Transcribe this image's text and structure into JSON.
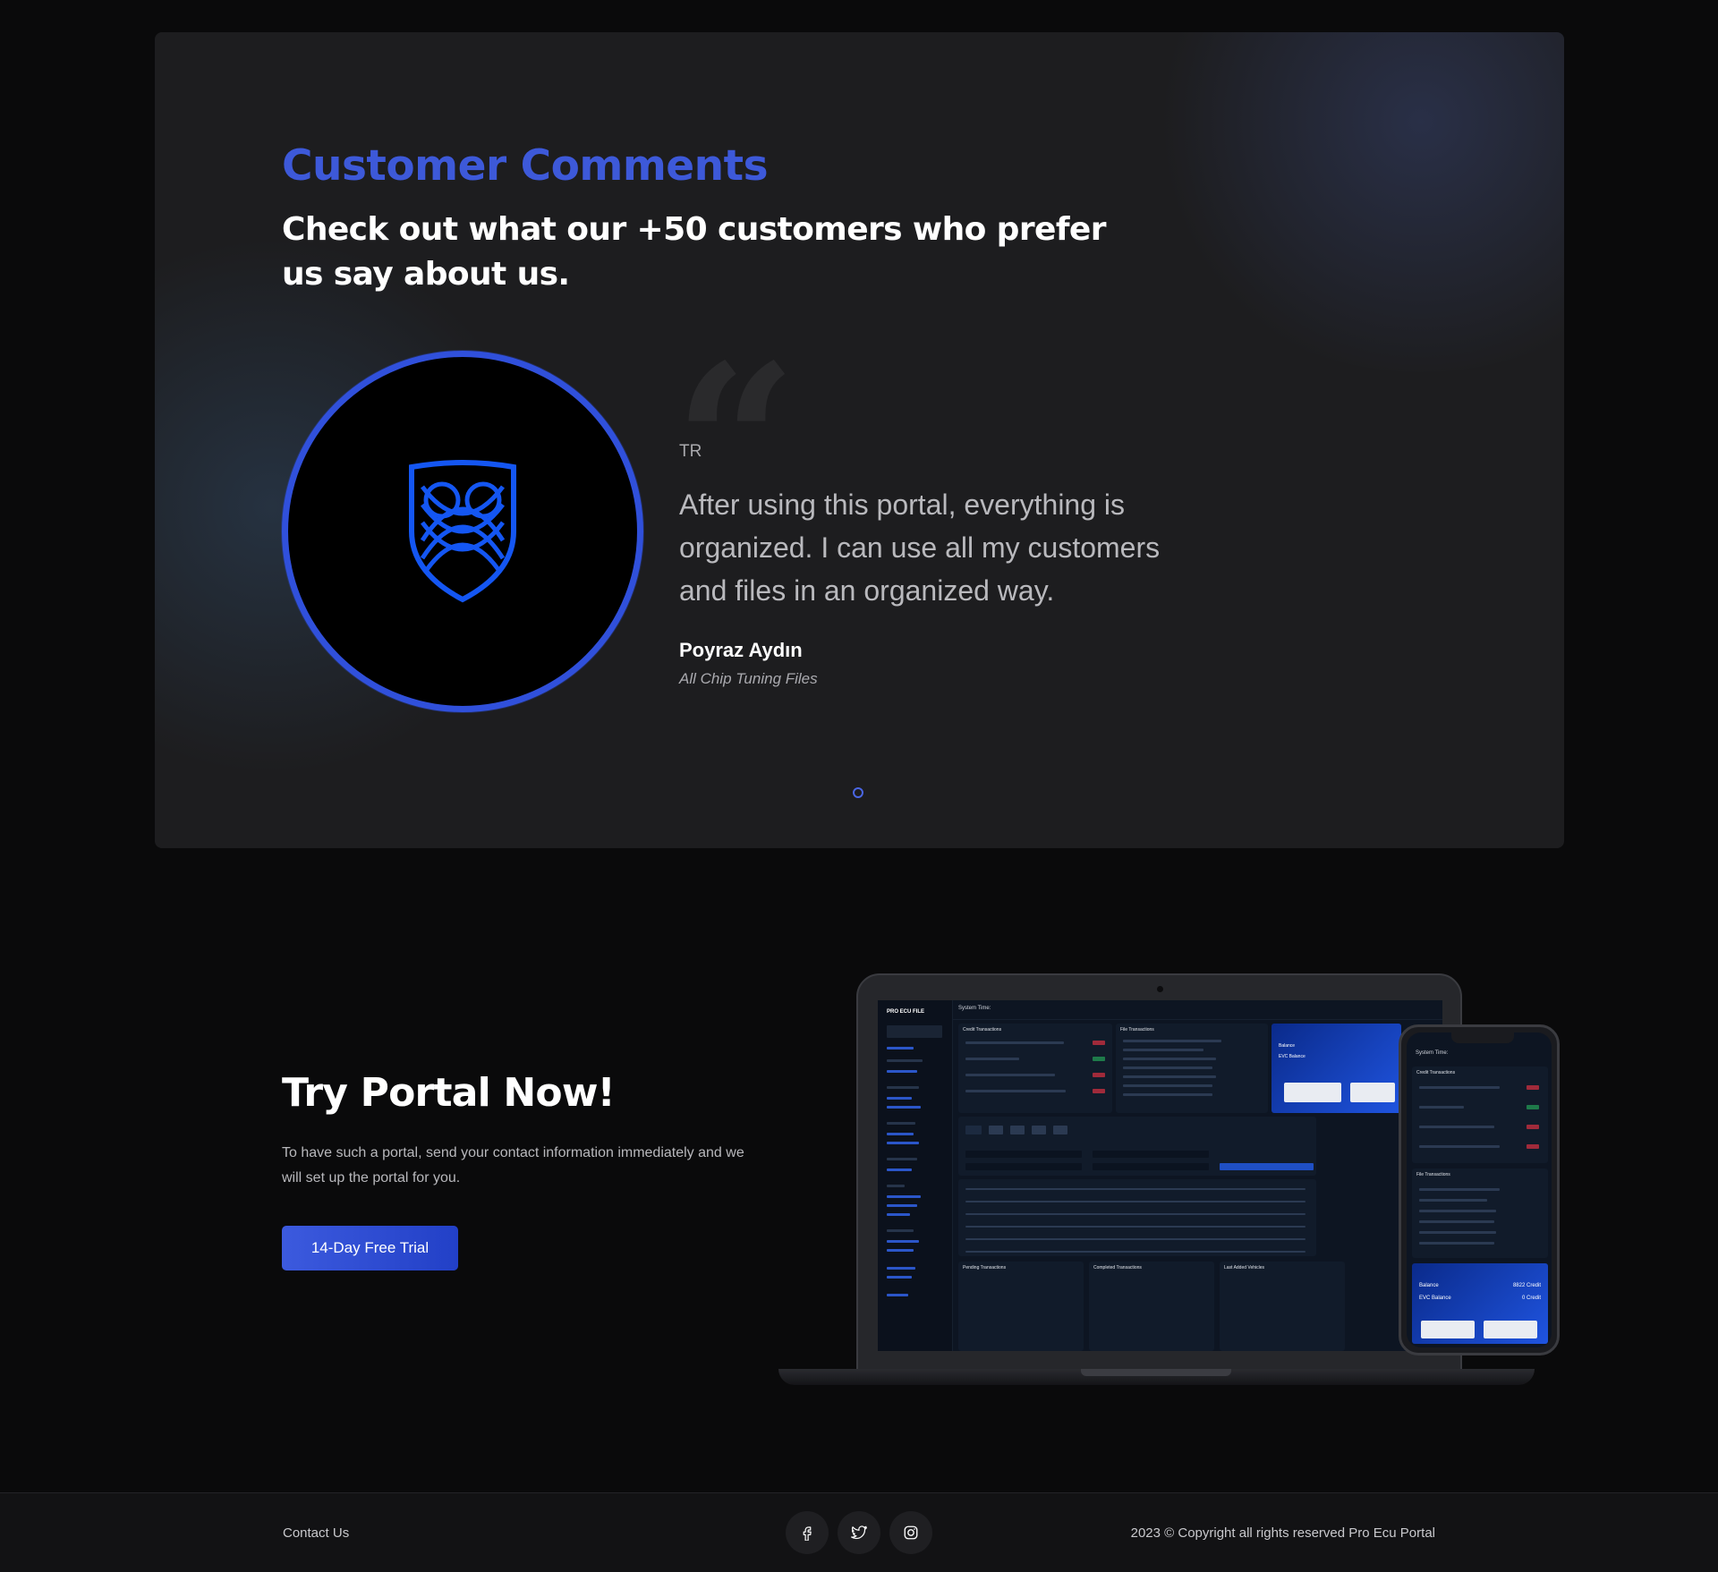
{
  "comments": {
    "eyebrow": "Customer Comments",
    "heading": "Check out what our +50 customers who prefer us say about us.",
    "testimonial": {
      "language": "TR",
      "text": "After using this portal, everything is organized. I can use all my customers and files in an organized way.",
      "author": "Poyraz Aydın",
      "company": "All Chip Tuning Files"
    },
    "quote_glyph": "“"
  },
  "try_portal": {
    "title": "Try Portal Now!",
    "description": "To have such a portal, send your contact information immediately and we will set up the portal for you.",
    "button_label": "14-Day Free Trial"
  },
  "mockup": {
    "brand": "PRO ECU FILE",
    "system_time": "System Time:",
    "credit_transactions": "Credit Transactions",
    "file_transactions": "File Transactions",
    "balance": "Balance",
    "evc_balance": "EVC Balance",
    "phone_balance_credit": "8822 Credit",
    "phone_evc_credit": "0 Credit",
    "pending_transactions": "Pending Transactions",
    "completed_transactions": "Completed Transactions",
    "last_added_vehicles": "Last Added Vehicles"
  },
  "footer": {
    "contact": "Contact Us",
    "copyright": "2023 © Copyright all rights reserved Pro Ecu Portal",
    "socials": [
      "facebook-icon",
      "twitter-icon",
      "instagram-icon"
    ]
  },
  "colors": {
    "accent": "#3d59d9",
    "background": "#0a0a0b",
    "card": "#1d1d1f"
  }
}
